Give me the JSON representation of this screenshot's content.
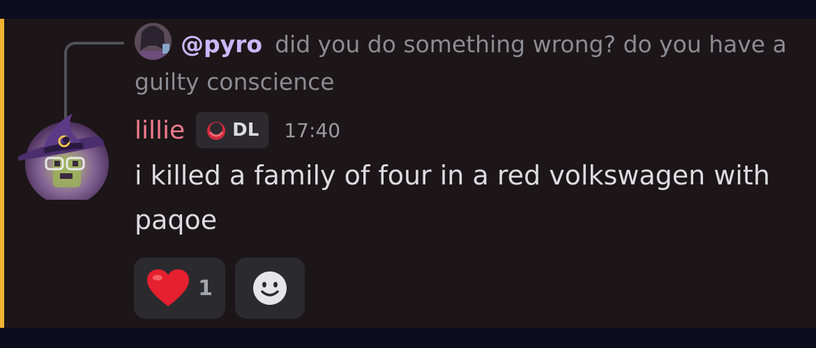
{
  "reply": {
    "mention": "@pyro",
    "text": "did you do something wrong? do you have a guilty conscience"
  },
  "message": {
    "author": "lillie",
    "tag_label": "DL",
    "timestamp": "17:40",
    "text": "i killed a family of four in a red volkswagen with paqoe"
  },
  "reactions": [
    {
      "emoji": "red-heart-icon",
      "count": "1"
    },
    {
      "emoji": "add-reaction-smiley-icon"
    }
  ],
  "colors": {
    "accent": "#f0b232",
    "author": "#f07a8c",
    "mention": "#c9b7ff",
    "panel": "#1c1618"
  }
}
